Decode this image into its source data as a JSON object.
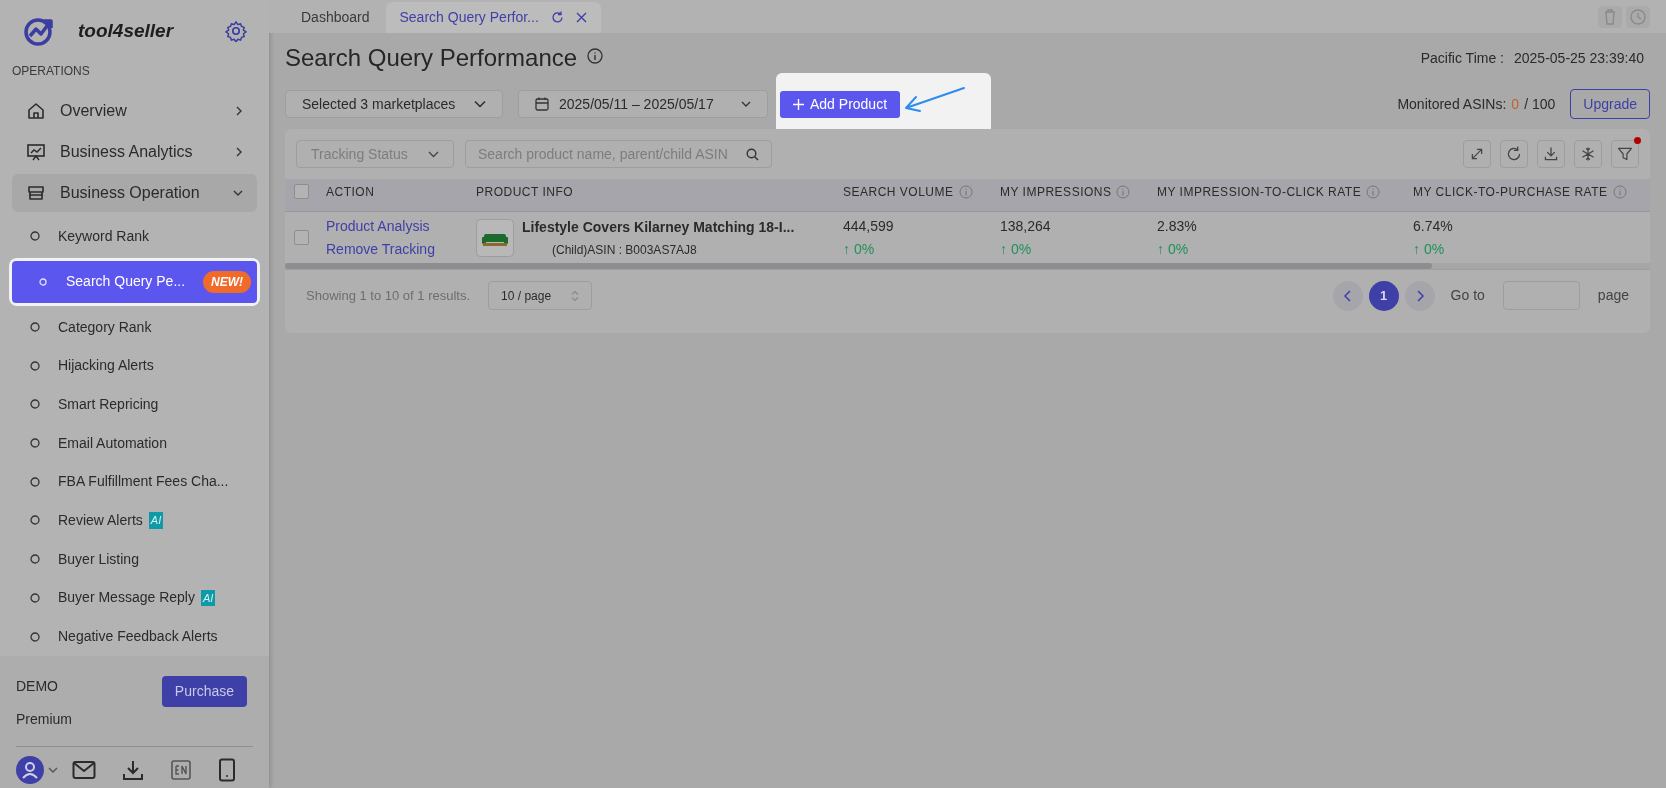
{
  "brand": {
    "name": "tool4seller"
  },
  "sidebar": {
    "section": "OPERATIONS",
    "groups": [
      {
        "label": "Overview",
        "expanded": false
      },
      {
        "label": "Business Analytics",
        "expanded": false
      },
      {
        "label": "Business Operation",
        "expanded": true,
        "children": [
          {
            "label": "Keyword Rank",
            "selected": false
          },
          {
            "label": "Search Query Pe...",
            "selected": true,
            "badge": {
              "kind": "new",
              "text": "NEW!"
            }
          },
          {
            "label": "Category Rank",
            "selected": false
          },
          {
            "label": "Hijacking Alerts",
            "selected": false
          },
          {
            "label": "Smart Repricing",
            "selected": false
          },
          {
            "label": "Email Automation",
            "selected": false
          },
          {
            "label": "FBA Fulfillment Fees Cha...",
            "selected": false
          },
          {
            "label": "Review Alerts",
            "selected": false,
            "badge": {
              "kind": "ai",
              "text": "AI"
            }
          },
          {
            "label": "Buyer Listing",
            "selected": false
          },
          {
            "label": "Buyer Message Reply",
            "selected": false,
            "badge": {
              "kind": "ai",
              "text": "AI"
            }
          },
          {
            "label": "Negative Feedback Alerts",
            "selected": false
          }
        ]
      }
    ]
  },
  "account": {
    "name": "DEMO",
    "plan": "Premium",
    "button": "Purchase"
  },
  "tabs": [
    {
      "label": "Dashboard",
      "selected": false
    },
    {
      "label": "Search Query Perfor...",
      "selected": true
    }
  ],
  "page": {
    "title": "Search Query Performance",
    "time_label": "Pacific Time :",
    "time_value": "2025-05-25 23:39:40",
    "marketplaces": "Selected 3 marketplaces",
    "date_range": "2025/05/11 – 2025/05/17",
    "add_button": "Add Product",
    "monitored_label": "Monitored ASINs:",
    "monitored_used": "0",
    "monitored_total": "/ 100",
    "upgrade": "Upgrade"
  },
  "filters": {
    "status_placeholder": "Tracking Status",
    "search_placeholder": "Search product name, parent/child ASIN"
  },
  "table": {
    "select_all_checked": false,
    "columns": [
      {
        "label": "ACTION",
        "info": false
      },
      {
        "label": "PRODUCT INFO",
        "info": false
      },
      {
        "label": "SEARCH VOLUME",
        "info": true
      },
      {
        "label": "MY IMPRESSIONS",
        "info": true
      },
      {
        "label": "MY IMPRESSION-TO-CLICK RATE",
        "info": true
      },
      {
        "label": "MY CLICK-TO-PURCHASE RATE",
        "info": true
      }
    ],
    "rows": [
      {
        "checked": false,
        "actions": [
          "Product Analysis",
          "Remove Tracking"
        ],
        "title": "Lifestyle Covers Kilarney Matching 18-I...",
        "asin": "(Child)ASIN : B003AS7AJ8",
        "metrics": [
          {
            "value": "444,599",
            "change": "↑ 0%"
          },
          {
            "value": "138,264",
            "change": "↑ 0%"
          },
          {
            "value": "2.83%",
            "change": "↑ 0%"
          },
          {
            "value": "6.74%",
            "change": "↑ 0%"
          }
        ]
      }
    ]
  },
  "pagination": {
    "summary": "Showing 1 to 10 of 1 results.",
    "page_size": "10 / page",
    "pages": [
      {
        "label": "1",
        "selected": true
      }
    ],
    "goto": "Go to",
    "page_word": "page"
  }
}
